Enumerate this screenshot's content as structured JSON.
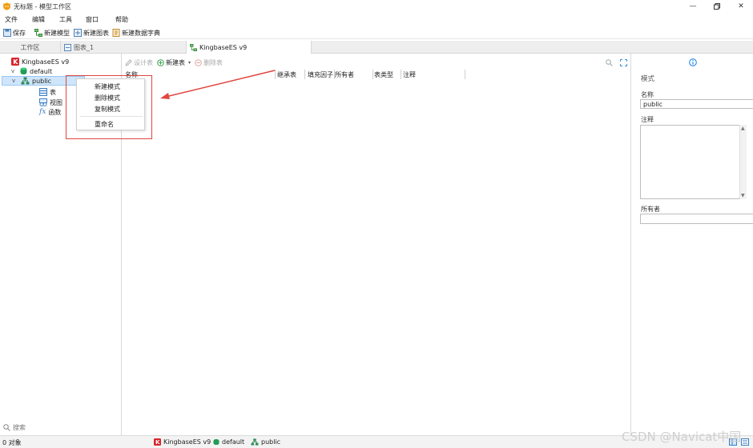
{
  "window": {
    "title": "无标题 - 模型工作区"
  },
  "menu": [
    "文件",
    "编辑",
    "工具",
    "窗口",
    "帮助"
  ],
  "toolbar": {
    "save": "保存",
    "new_model": "新建模型",
    "new_chart": "新建图表",
    "new_dictionary": "新建数据字典"
  },
  "tabs": [
    "工作区",
    "图表_1",
    "KingbaseES v9"
  ],
  "tree": {
    "connection": "KingbaseES v9",
    "database": "default",
    "schema": "public",
    "children": [
      "表",
      "视图",
      "函数"
    ]
  },
  "context_menu": {
    "items": [
      "新建模式",
      "删除模式",
      "复制模式"
    ],
    "rename": "重命名"
  },
  "center_toolbar": {
    "design_table": "设计表",
    "new_table": "新建表",
    "delete_table": "删除表"
  },
  "columns": [
    "名称",
    "继承表",
    "填充因子",
    "所有者",
    "表类型",
    "注释"
  ],
  "right_panel": {
    "section": "模式",
    "name_label": "名称",
    "name_value": "public",
    "comment_label": "注释",
    "comment_value": "",
    "owner_label": "所有者",
    "owner_value": ""
  },
  "search": {
    "placeholder": "搜索"
  },
  "status": {
    "objects": "0 对象",
    "connection": "KingbaseES v9",
    "database": "default",
    "schema": "public"
  },
  "watermark": "CSDN @Navicat中国",
  "colors": {
    "accent": "#1e88e5",
    "highlight": "#e0463f",
    "selected": "#cfe5fb",
    "kingbase_red": "#d7262c",
    "db_green": "#1f9d55"
  }
}
